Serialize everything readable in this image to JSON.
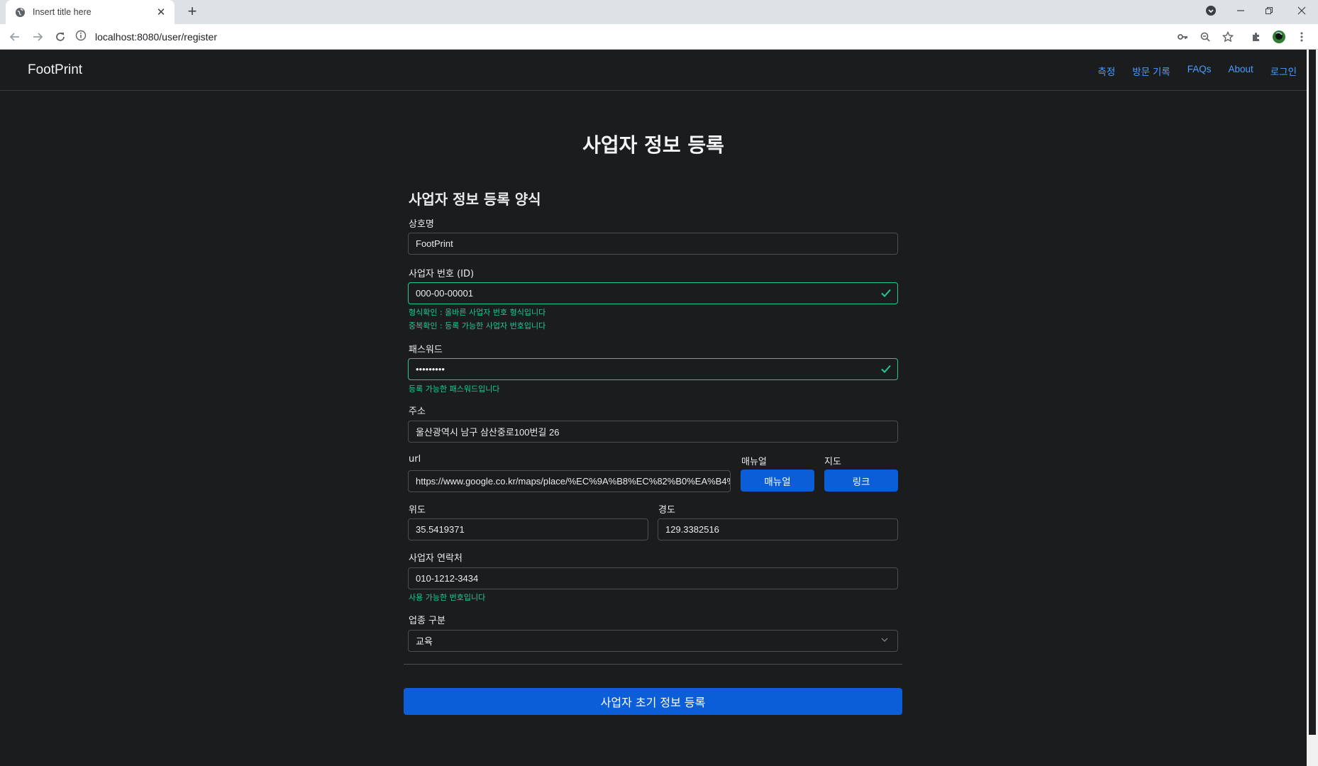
{
  "browser": {
    "tab_title": "Insert title here",
    "tab_close": "✕",
    "new_tab": "+",
    "url": "localhost:8080/user/register"
  },
  "navbar": {
    "brand": "FootPrint",
    "links": [
      "측정",
      "방문 기록",
      "FAQs",
      "About",
      "로그인"
    ],
    "link_color": "#4a9eff"
  },
  "page": {
    "title": "사업자 정보 등록",
    "form_title": "사업자 정보 등록 양식"
  },
  "form": {
    "business_name": {
      "label": "상호명",
      "value": "FootPrint"
    },
    "business_number": {
      "label": "사업자 번호 (ID)",
      "value": "000-00-00001",
      "msg_format": "형식확인 : 올바른 사업자 번호 형식입니다",
      "msg_duplicate": "중복확인 : 등록 가능한 사업자 번호입니다"
    },
    "password": {
      "label": "패스워드",
      "value": "•••••••••",
      "msg": "등록 가능한 패스워드입니다"
    },
    "address": {
      "label": "주소",
      "value": "울산광역시 남구 삼산중로100번길 26"
    },
    "url": {
      "label": "url",
      "value": "https://www.google.co.kr/maps/place/%EC%9A%B8%EC%82%B0%EA%B4%91"
    },
    "manual": {
      "label": "매뉴얼",
      "button": "매뉴얼"
    },
    "map": {
      "label": "지도",
      "button": "링크"
    },
    "latitude": {
      "label": "위도",
      "value": "35.5419371"
    },
    "longitude": {
      "label": "경도",
      "value": "129.3382516"
    },
    "contact": {
      "label": "사업자 연락처",
      "value": "010-1212-3434",
      "msg": "사용 가능한 번호입니다"
    },
    "category": {
      "label": "업종 구분",
      "value": "교육"
    },
    "submit": "사업자 초기 정보 등록"
  },
  "colors": {
    "background": "#1b1c1e",
    "primary": "#0b5ed7",
    "valid": "#20c997"
  }
}
